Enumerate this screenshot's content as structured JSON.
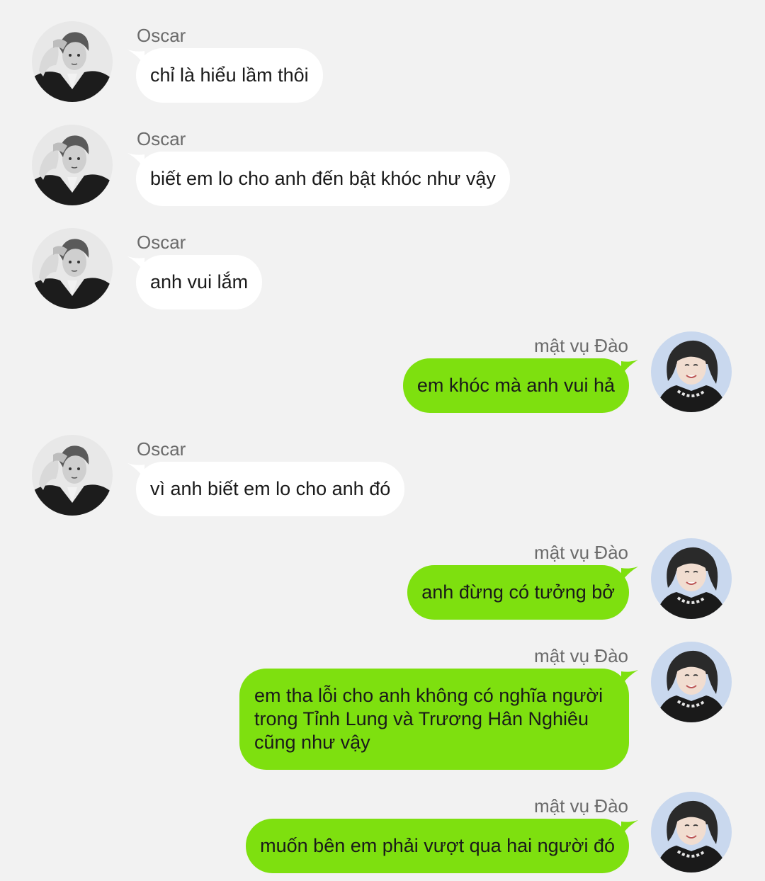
{
  "contacts": {
    "other": {
      "name": "Oscar",
      "avatar_icon": "oscar-avatar",
      "bubble_color": "#ffffff"
    },
    "me": {
      "name": "mật vụ Đào",
      "avatar_icon": "dao-avatar",
      "bubble_color": "#7ee00f"
    }
  },
  "messages": [
    {
      "sender": "Oscar",
      "text": "chỉ là hiểu lầm thôi"
    },
    {
      "sender": "Oscar",
      "text": "biết em lo cho anh đến bật khóc như vậy"
    },
    {
      "sender": "Oscar",
      "text": "anh vui lắm"
    },
    {
      "sender": "mật vụ Đào",
      "text": "em khóc mà anh vui hả"
    },
    {
      "sender": "Oscar",
      "text": "vì anh biết em lo cho anh đó"
    },
    {
      "sender": "mật vụ Đào",
      "text": "anh đừng có tưởng bở"
    },
    {
      "sender": "mật vụ Đào",
      "text": "em tha lỗi cho anh không có nghĩa người trong Tỉnh Lung và Trương Hân Nghiêu cũng như vậy"
    },
    {
      "sender": "mật vụ Đào",
      "text": "muốn bên em phải vượt qua hai người đó"
    }
  ]
}
